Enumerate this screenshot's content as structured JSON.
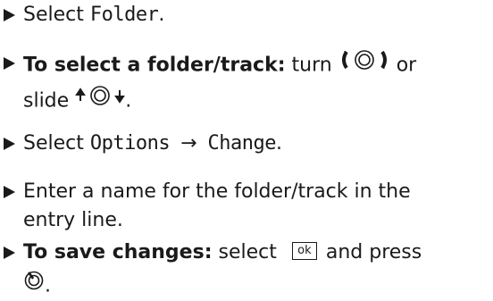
{
  "steps": [
    {
      "pre": "Select ",
      "code": "Folder",
      "post": "."
    },
    {
      "bold": "To select a folder/track:",
      "mid": " turn ",
      "mid2": " or",
      "line2_pre": "slide ",
      "line2_post": "."
    },
    {
      "pre": "Select ",
      "code1": "Options",
      "arrow": "→",
      "code2": "Change",
      "post": "."
    },
    {
      "line1": "Enter a name for the folder/track in the",
      "line2": "entry line."
    },
    {
      "bold": "To save changes:",
      "mid": " select ",
      "ok": "ok",
      "mid2": "and press",
      "line2_post": "."
    }
  ],
  "icons": {
    "turn": "rotary-turn-icon",
    "slide": "controller-slide-icon",
    "press": "controller-press-icon",
    "bullet": "triangle-bullet-icon"
  }
}
